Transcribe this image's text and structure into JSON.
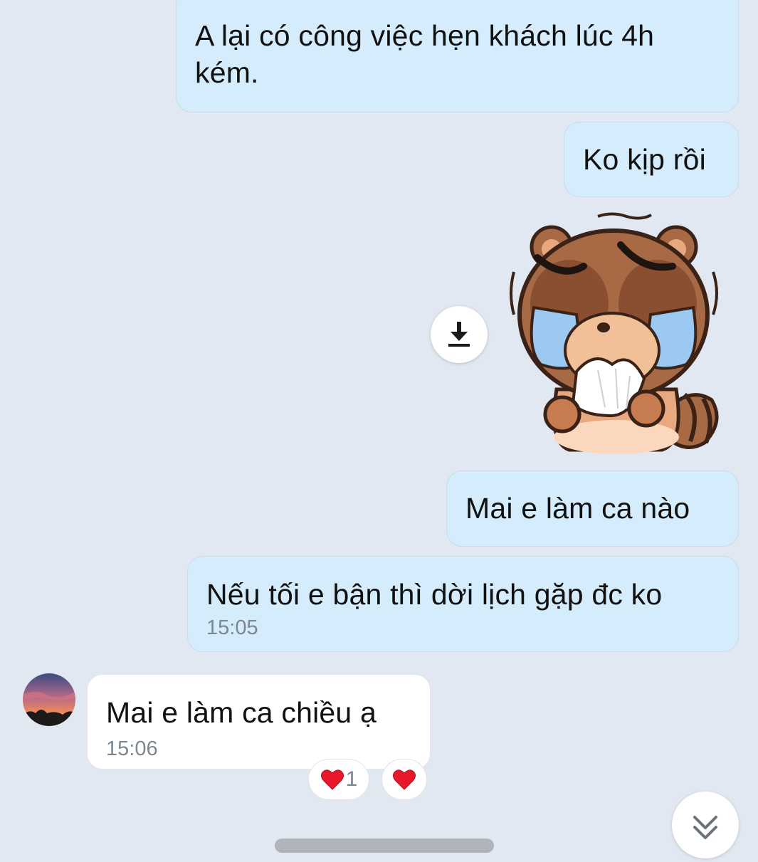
{
  "messages": [
    {
      "direction": "outgoing",
      "text": "A lại có công việc hẹn khách lúc 4h kém.",
      "time": ""
    },
    {
      "direction": "outgoing",
      "text": "Ko kịp rồi",
      "time": ""
    },
    {
      "direction": "outgoing",
      "type": "sticker",
      "sticker_icon": "crying-raccoon-sticker",
      "action_icon": "download-icon"
    },
    {
      "direction": "outgoing",
      "text": "Mai e làm ca nào",
      "time": ""
    },
    {
      "direction": "outgoing",
      "text": "Nếu tối e bận thì dời lịch gặp đc ko",
      "time": "15:05"
    },
    {
      "direction": "incoming",
      "text": "Mai e làm ca chiều ạ",
      "time": "15:06",
      "avatar_icon": "sunset-avatar"
    }
  ],
  "reactions": {
    "heart_count": "1",
    "icon": "heart-icon"
  },
  "controls": {
    "scroll_icon": "double-chevron-down-icon"
  },
  "colors": {
    "background": "#e2e8f1",
    "outgoing_bubble": "#d4ecfb",
    "incoming_bubble": "#ffffff",
    "timestamp": "#7c8791",
    "heart": "#e8182c"
  }
}
